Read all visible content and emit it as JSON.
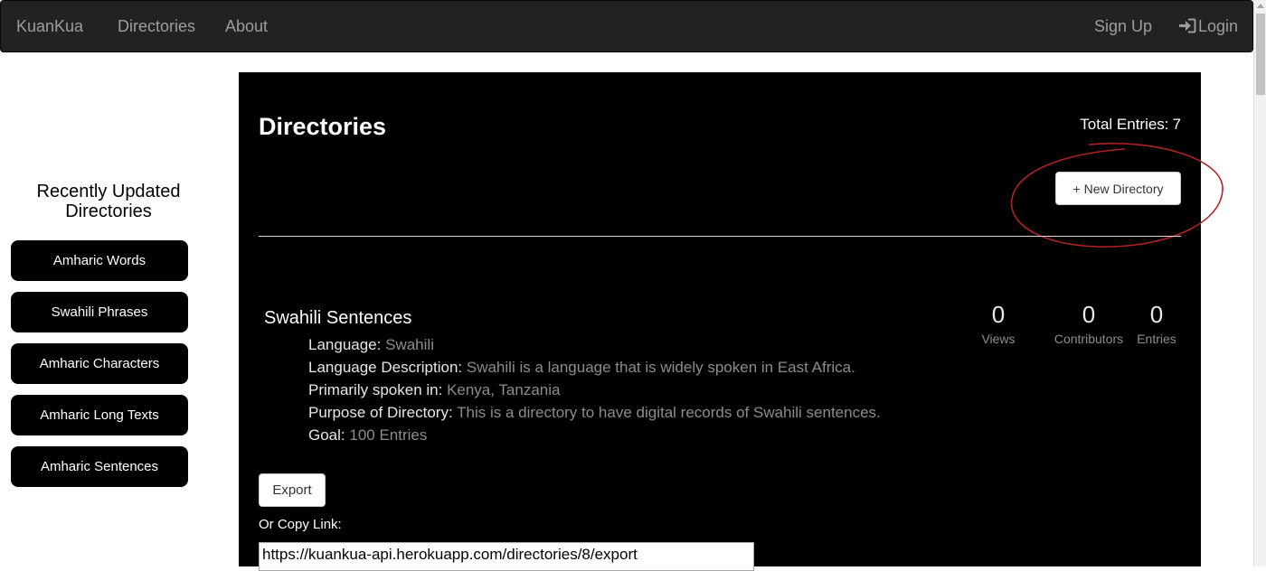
{
  "navbar": {
    "brand": "KuanKua",
    "links": [
      "Directories",
      "About"
    ],
    "sign_up": "Sign Up",
    "login": "Login",
    "login_icon": "sign-in-icon"
  },
  "sidebar": {
    "title": "Recently Updated Directories",
    "items": [
      {
        "label": "Amharic Words"
      },
      {
        "label": "Swahili Phrases"
      },
      {
        "label": "Amharic Characters"
      },
      {
        "label": "Amharic Long Texts"
      },
      {
        "label": "Amharic Sentences"
      }
    ]
  },
  "main": {
    "title": "Directories",
    "total_entries_label": "Total Entries:",
    "total_entries_value": "7",
    "new_directory_label": "+ New Directory",
    "annotation_color": "#b22222"
  },
  "directory": {
    "name": "Swahili Sentences",
    "details": [
      {
        "label": "Language:",
        "value": "Swahili"
      },
      {
        "label": "Language Description:",
        "value": "Swahili is a language that is widely spoken in East Africa."
      },
      {
        "label": "Primarily spoken in:",
        "value": "Kenya, Tanzania"
      },
      {
        "label": "Purpose of Directory:",
        "value": "This is a directory to have digital records of Swahili sentences."
      },
      {
        "label": "Goal:",
        "value": "100 Entries"
      }
    ],
    "stats": {
      "views": {
        "value": "0",
        "label": "Views"
      },
      "contributors": {
        "value": "0",
        "label": "Contributors"
      },
      "entries": {
        "value": "0",
        "label": "Entries"
      }
    },
    "export_label": "Export",
    "copy_link_label": "Or Copy Link:",
    "export_url": "https://kuankua-api.herokuapp.com/directories/8/export"
  },
  "colors": {
    "navbar_bg": "#222222",
    "navbar_text": "#9d9d9d",
    "panel_bg": "#000000",
    "muted_text": "#8c8c8c"
  }
}
